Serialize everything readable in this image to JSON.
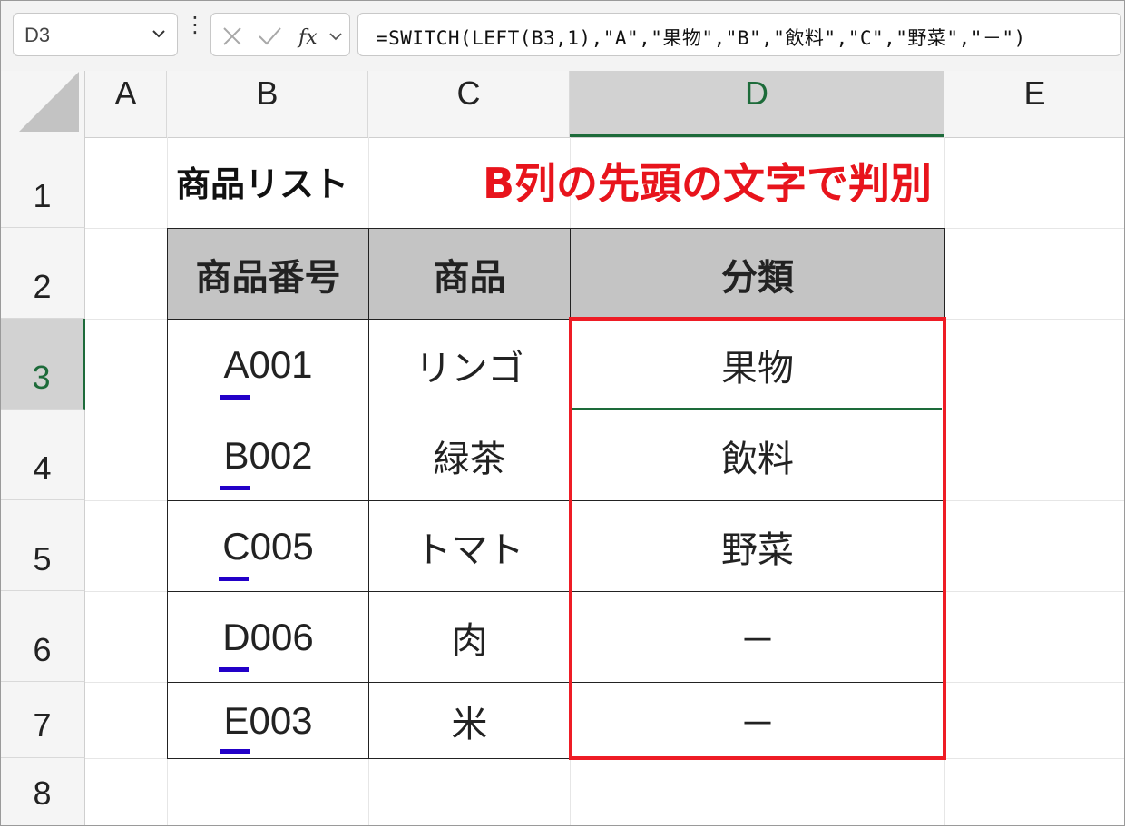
{
  "formula_bar": {
    "name_box": "D3",
    "formula": "=SWITCH(LEFT(B3,1),\"A\",\"果物\",\"B\",\"飲料\",\"C\",\"野菜\",\"－\")"
  },
  "columns": [
    "A",
    "B",
    "C",
    "D",
    "E"
  ],
  "active_column": "D",
  "rows": [
    "1",
    "2",
    "3",
    "4",
    "5",
    "6",
    "7",
    "8"
  ],
  "active_row": "3",
  "sheet": {
    "title": "商品リスト",
    "annotation": "B列の先頭の文字で判別",
    "table": {
      "headers": [
        "商品番号",
        "商品",
        "分類"
      ],
      "rows": [
        {
          "code": "A001",
          "product": "リンゴ",
          "category": "果物"
        },
        {
          "code": "B002",
          "product": "緑茶",
          "category": "飲料"
        },
        {
          "code": "C005",
          "product": "トマト",
          "category": "野菜"
        },
        {
          "code": "D006",
          "product": "肉",
          "category": "－"
        },
        {
          "code": "E003",
          "product": "米",
          "category": "－"
        }
      ]
    }
  },
  "colors": {
    "annotation": "#e8141c",
    "highlight_border": "#ee1c25",
    "underline": "#2200c8",
    "active_header": "#1d6b3a",
    "table_header_bg": "#c4c4c4"
  }
}
